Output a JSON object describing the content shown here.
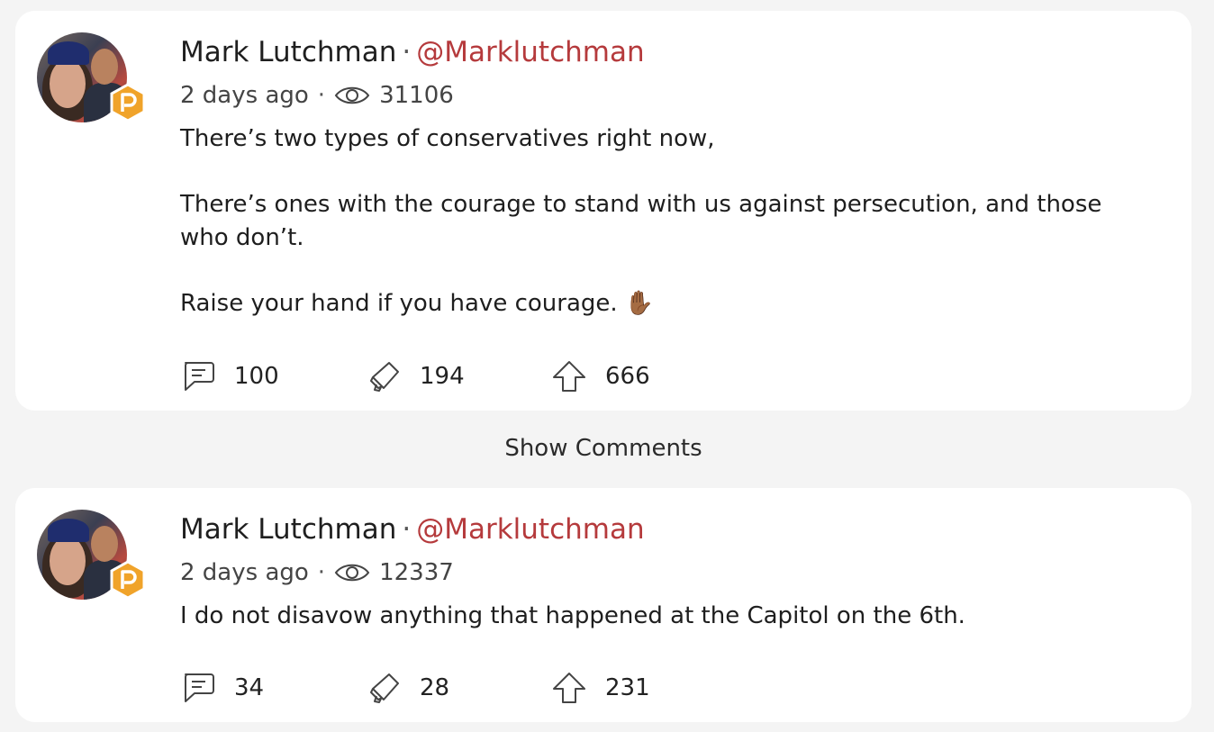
{
  "posts": [
    {
      "author_name": "Mark Lutchman",
      "separator": "·",
      "handle": "@Marklutchman",
      "time_ago": "2 days ago",
      "views": "31106",
      "paragraphs": [
        "There’s two types of conservatives right now,",
        "There’s ones with the courage to stand with us against persecution, and those who don’t.",
        "Raise your hand if you have courage. ✋🏾"
      ],
      "comments_count": "100",
      "echoes_count": "194",
      "upvotes_count": "666"
    },
    {
      "author_name": "Mark Lutchman",
      "separator": "·",
      "handle": "@Marklutchman",
      "time_ago": "2 days ago",
      "views": "12337",
      "paragraphs": [
        "I do not disavow anything that happened at the Capitol on the 6th."
      ],
      "comments_count": "34",
      "echoes_count": "28",
      "upvotes_count": "231"
    }
  ],
  "show_comments_label": "Show Comments",
  "colors": {
    "handle": "#b53a3c",
    "badge": "#f0a32a",
    "background": "#f4f4f4",
    "card": "#ffffff"
  },
  "icons": {
    "views": "eye-icon",
    "comments": "comment-bubble-icon",
    "echoes": "megaphone-icon",
    "upvotes": "up-arrow-icon",
    "badge": "parler-badge-icon"
  }
}
